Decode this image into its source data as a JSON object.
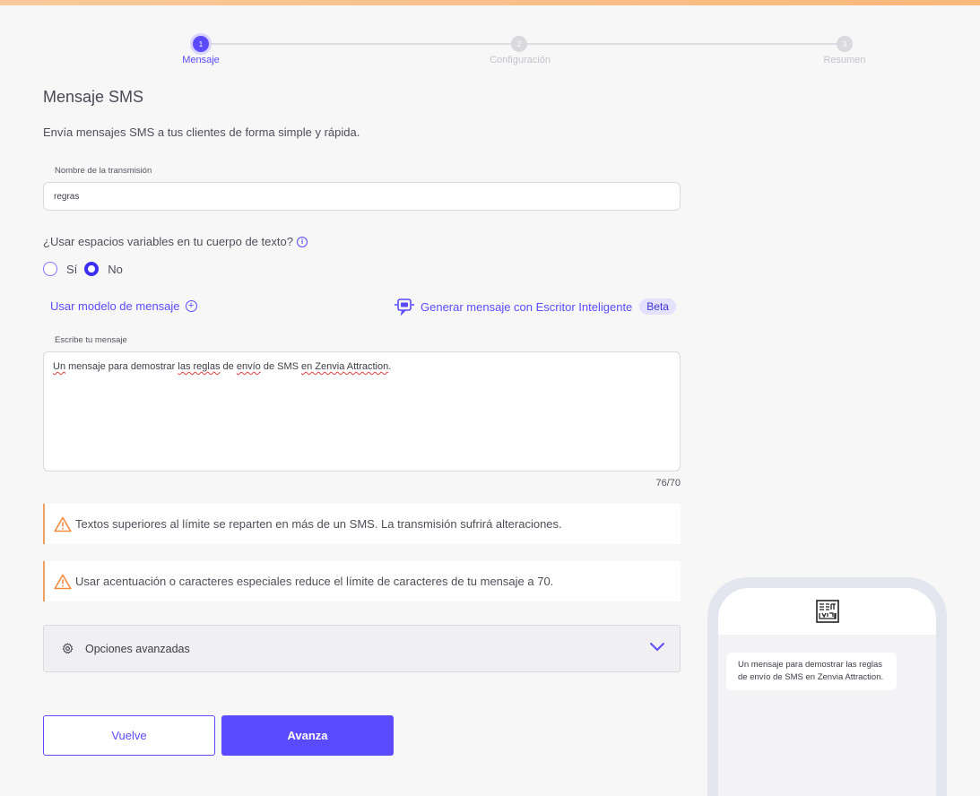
{
  "stepper": {
    "steps": [
      {
        "number": "1",
        "label": "Mensaje"
      },
      {
        "number": "2",
        "label": "Configuración"
      },
      {
        "number": "3",
        "label": "Resumen"
      }
    ]
  },
  "page": {
    "title": "Mensaje SMS",
    "subtitle": "Envía mensajes SMS a tus clientes de forma simple y rápida."
  },
  "form": {
    "name_label": "Nombre de la transmisión",
    "name_value": "regras",
    "variables_question": "¿Usar espacios variables en tu cuerpo de texto?",
    "variables_options": [
      {
        "label": "Sí",
        "checked": false
      },
      {
        "label": "No",
        "checked": true
      }
    ],
    "template_link": "Usar modelo de mensaje",
    "smart_writer_link": "Generar mensaje con Escritor Inteligente",
    "beta_badge": "Beta",
    "message_label": "Escribe tu mensaje",
    "message_parts": {
      "p1": "Un",
      "p2": " mensaje para demostrar ",
      "p3": "las reglas",
      "p4": " de ",
      "p5": "envío",
      "p6": " de SMS ",
      "p7": "en Zenvia Attraction",
      "p8": "."
    },
    "counter": "76/70"
  },
  "warnings": [
    "Textos superiores al límite se reparten en más de un SMS. La transmisión sufrirá alteraciones.",
    "Usar acentuación o caracteres especiales reduce el límite de caracteres de tu mensaje a 70."
  ],
  "advanced": {
    "label": "Opciones avanzadas"
  },
  "buttons": {
    "back": "Vuelve",
    "next": "Avanza"
  },
  "preview": {
    "message": "Un mensaje para demostrar las reglas de envío de SMS en Zenvia Attraction."
  },
  "colors": {
    "accent": "#5b4bff",
    "warning": "#f0a060"
  }
}
